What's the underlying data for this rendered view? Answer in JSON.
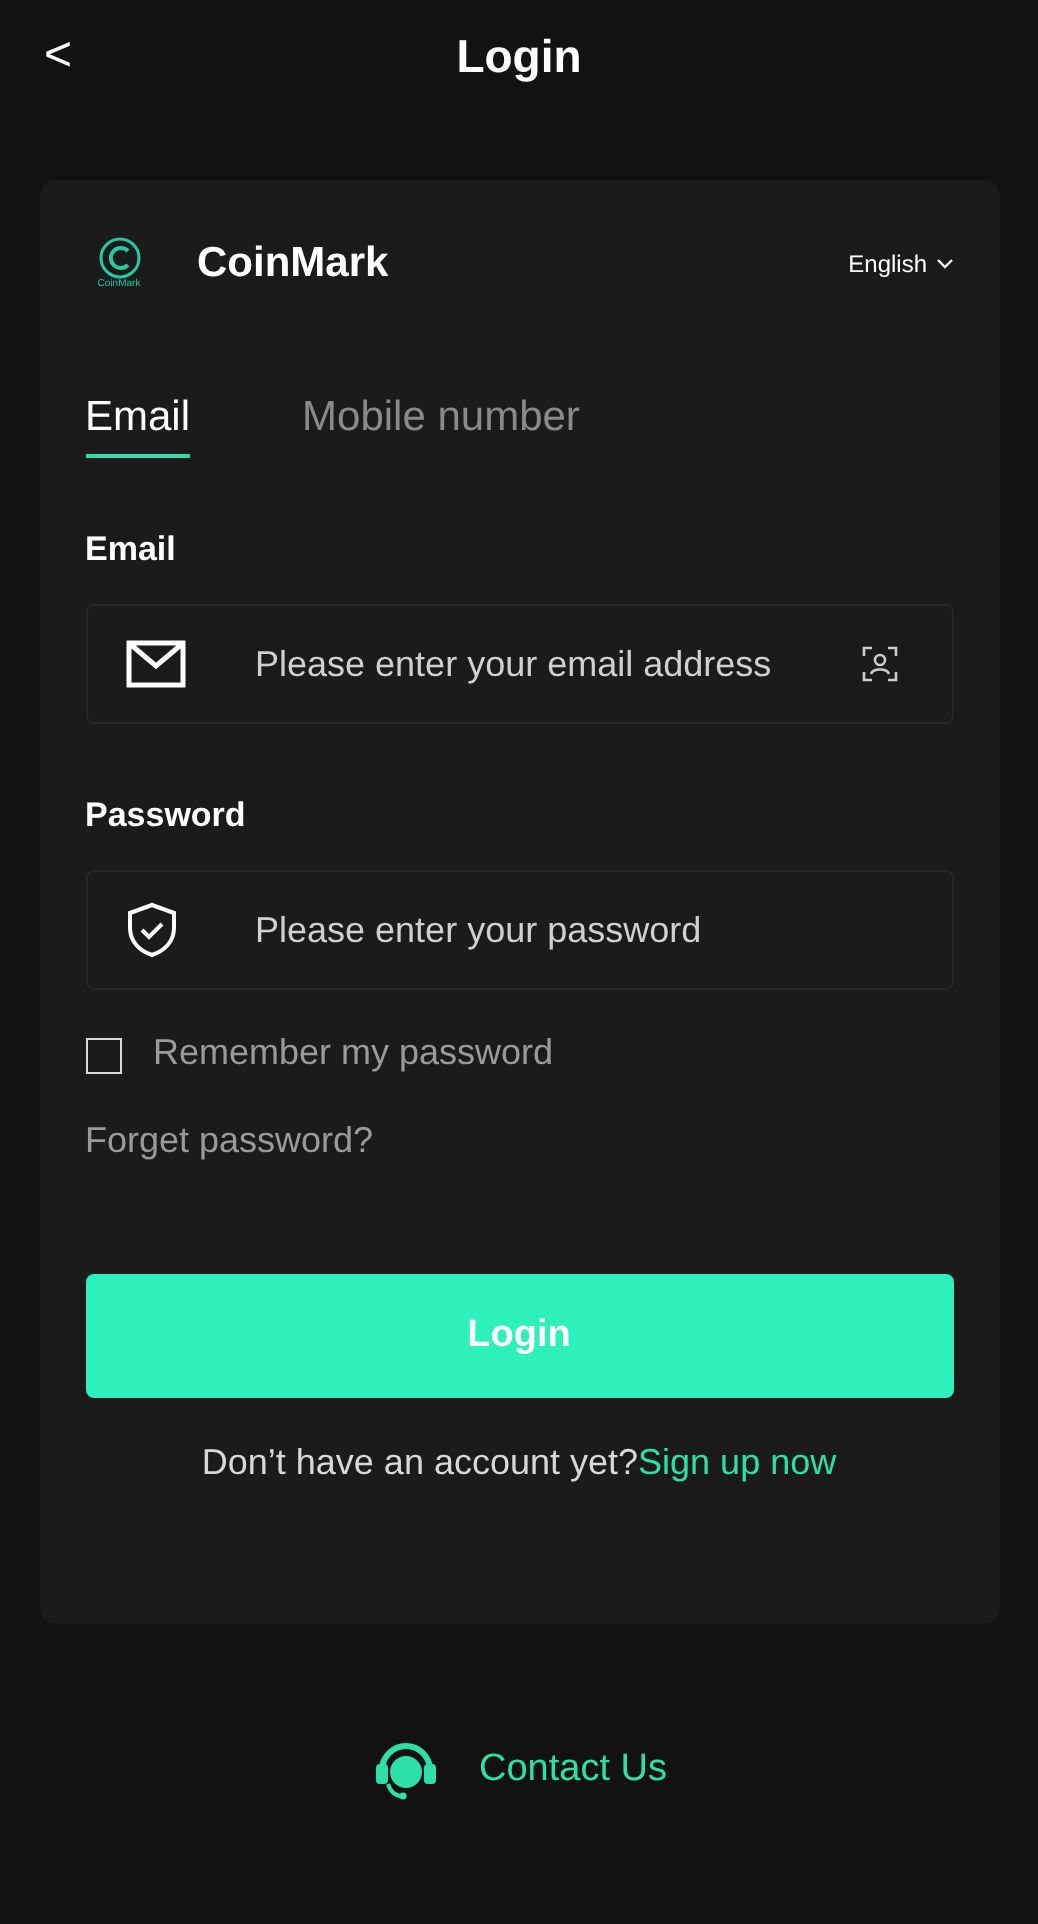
{
  "header": {
    "back": "<",
    "title": "Login"
  },
  "brand": {
    "name": "CoinMark",
    "logo_caption": "CoinMark",
    "language": "English"
  },
  "tabs": [
    {
      "label": "Email",
      "selected": true
    },
    {
      "label": "Mobile number",
      "selected": false
    }
  ],
  "fields": [
    {
      "kind": "email",
      "label": "Email",
      "placeholder": "Please enter your email address"
    },
    {
      "kind": "password",
      "label": "Password",
      "placeholder": "Please enter your password"
    }
  ],
  "remember": {
    "label": "Remember my password",
    "checked": false
  },
  "forgot": "Forget password?",
  "login_button": "Login",
  "signup": {
    "prompt": "Don’t have an account yet?",
    "link": "Sign up now"
  },
  "contact": "Contact Us"
}
